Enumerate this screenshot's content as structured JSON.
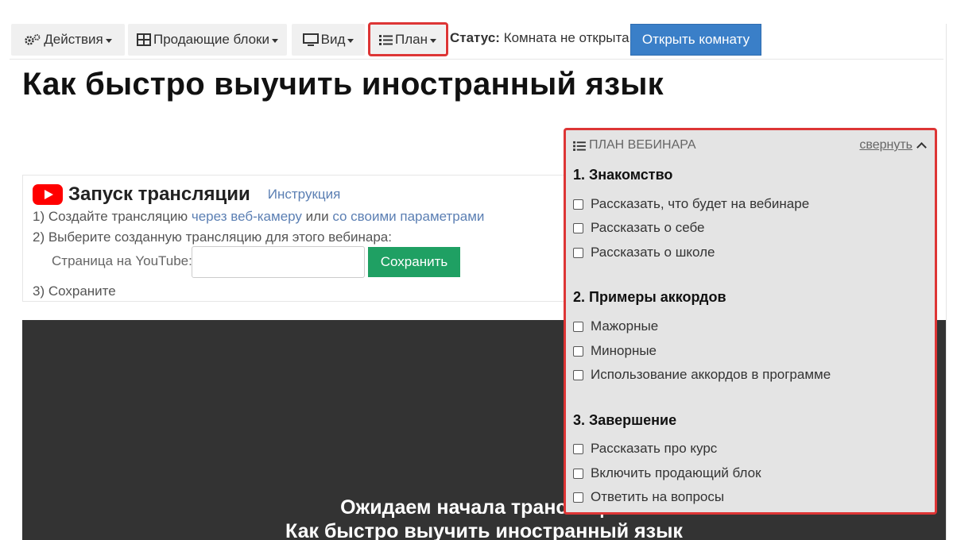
{
  "toolbar": {
    "actions_label": "Действия",
    "selling_blocks_label": "Продающие блоки",
    "view_label": "Вид",
    "plan_label": "План",
    "status_label": "Статус:",
    "status_value": "Комната не открыта",
    "open_room_label": "Открыть комнату"
  },
  "page": {
    "title": "Как быстро выучить иностранный язык"
  },
  "youtube": {
    "title": "Запуск трансляции",
    "instruction_link": "Инструкция",
    "step1_prefix": "1) Создайте трансляцию",
    "step1_link1": "через веб-камеру",
    "step1_or": "или",
    "step1_link2": "со своими параметрами",
    "step2": "2) Выберите созданную трансляцию для этого вебинара:",
    "field_label": "Страница на YouTube:",
    "field_value": "",
    "save_label": "Сохранить",
    "step3": "3) Сохраните"
  },
  "video": {
    "line1": "Ожидаем начала трансляции",
    "line2": "Как быстро выучить иностранный язык"
  },
  "plan": {
    "header": "ПЛАН ВЕБИНАРА",
    "collapse_label": "свернуть",
    "sections": [
      {
        "title": "1. Знакомство",
        "items": [
          "Рассказать, что будет на вебинаре",
          "Рассказать о себе",
          "Рассказать о школе"
        ]
      },
      {
        "title": "2. Примеры аккордов",
        "items": [
          "Мажорные",
          "Минорные",
          "Использование аккордов в программе"
        ]
      },
      {
        "title": "3. Завершение",
        "items": [
          "Рассказать про курс",
          "Включить продающий блок",
          "Ответить на вопросы"
        ]
      }
    ]
  },
  "colors": {
    "accent_blue": "#3a7fc8",
    "save_green": "#1fa063",
    "highlight_red": "#dd3535",
    "youtube_red": "#ff0000"
  }
}
